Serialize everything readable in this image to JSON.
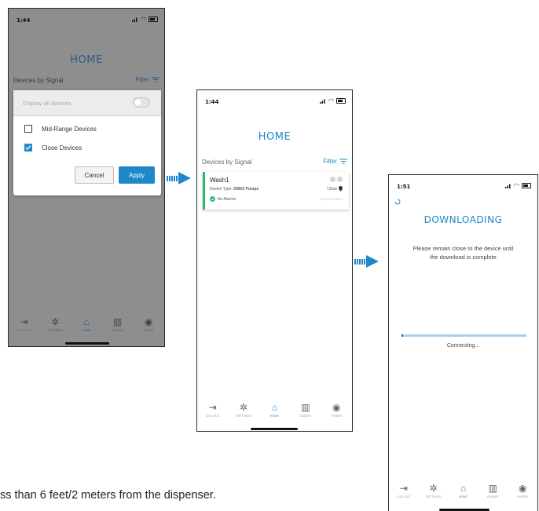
{
  "phone1": {
    "status_time": "1:44",
    "title": "HOME",
    "devices_label": "Devices by Signal",
    "filter_label": "Filter",
    "modal": {
      "display_all_label": "Display all devices",
      "mid_range_label": "Mid-Range Devices",
      "close_devices_label": "Close Devices",
      "cancel_label": "Cancel",
      "apply_label": "Apply"
    }
  },
  "phone2": {
    "status_time": "1:44",
    "title": "HOME",
    "devices_label": "Devices by Signal",
    "filter_label": "Filter",
    "device_card": {
      "name": "Wash1",
      "device_type_label": "Device Type:",
      "device_type_value": "DMX2 Pumps",
      "proximity": "Close",
      "alarms": "No Alarms",
      "hint": "Tap to connect"
    }
  },
  "phone3": {
    "status_time": "1:51",
    "title": "DOWNLOADING",
    "message": "Please remain close to the device until the download is complete",
    "progress_status": "Connecting...",
    "progress": 0.01
  },
  "tabbar": [
    {
      "label": "LOG-OUT",
      "icon": "logout-icon",
      "glyph": "⇥"
    },
    {
      "label": "SETTINGS",
      "icon": "gear-icon",
      "glyph": "✲"
    },
    {
      "label": "HOME",
      "icon": "home-icon",
      "glyph": "⌂"
    },
    {
      "label": "GUIDES",
      "icon": "book-icon",
      "glyph": "▥"
    },
    {
      "label": "HYDRO",
      "icon": "location-icon",
      "glyph": "◉"
    }
  ],
  "footer_text": "ss than 6 feet/2 meters from the dispenser.",
  "colors": {
    "accent": "#1e88c8",
    "success": "#2bb673"
  }
}
